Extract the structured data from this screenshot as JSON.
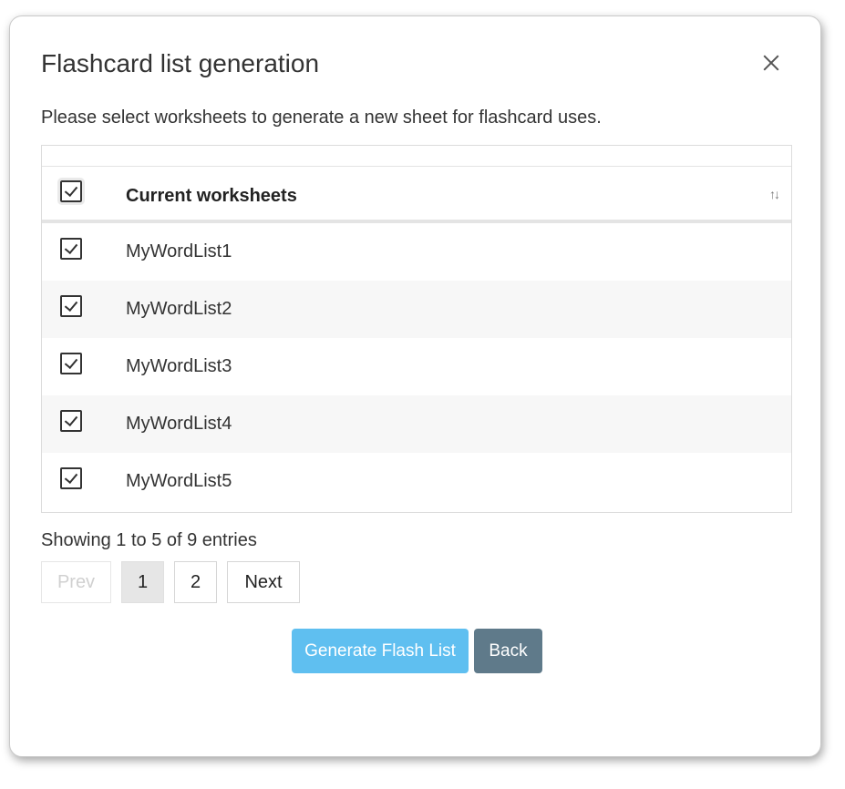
{
  "modal": {
    "title": "Flashcard list generation",
    "instructions": "Please select worksheets to generate a new sheet for flashcard uses."
  },
  "table": {
    "header": "Current worksheets",
    "select_all_checked": true,
    "rows": [
      {
        "name": "MyWordList1",
        "checked": true
      },
      {
        "name": "MyWordList2",
        "checked": true
      },
      {
        "name": "MyWordList3",
        "checked": true
      },
      {
        "name": "MyWordList4",
        "checked": true
      },
      {
        "name": "MyWordList5",
        "checked": true
      }
    ]
  },
  "pagination": {
    "info": "Showing 1 to 5 of 9 entries",
    "prev_label": "Prev",
    "pages": [
      "1",
      "2"
    ],
    "current_page": "1",
    "next_label": "Next"
  },
  "actions": {
    "generate_label": "Generate Flash List",
    "back_label": "Back"
  },
  "colors": {
    "primary": "#5fbff0",
    "secondary": "#5f7a8a"
  },
  "icons": {
    "close": "close-icon",
    "sort": "sort-icon"
  }
}
